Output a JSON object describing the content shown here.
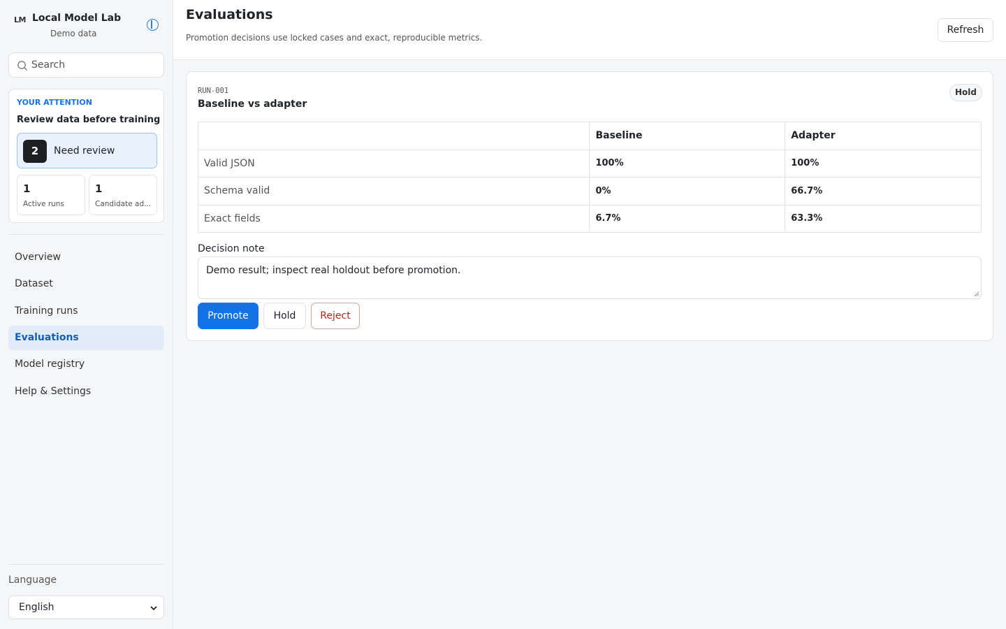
{
  "sidebar": {
    "logo_text": "LM",
    "app_name": "Local Model Lab",
    "app_sub": "Demo data",
    "search": {
      "placeholder": "Search"
    },
    "attention": {
      "eyebrow": "YOUR ATTENTION",
      "title": "Review data before training",
      "review_count": "2",
      "review_label": "Need review",
      "stats": [
        {
          "value": "1",
          "label": "Active runs"
        },
        {
          "value": "1",
          "label": "Candidate ad..."
        }
      ]
    },
    "nav": [
      {
        "label": "Overview",
        "active": false
      },
      {
        "label": "Dataset",
        "active": false
      },
      {
        "label": "Training runs",
        "active": false
      },
      {
        "label": "Evaluations",
        "active": true
      },
      {
        "label": "Model registry",
        "active": false
      },
      {
        "label": "Help & Settings",
        "active": false
      }
    ],
    "language": {
      "label": "Language",
      "value": "English"
    }
  },
  "header": {
    "title": "Evaluations",
    "subtitle": "Promotion decisions use locked cases and exact, reproducible metrics.",
    "refresh_label": "Refresh"
  },
  "evaluation": {
    "run_id": "RUN-001",
    "title": "Baseline vs adapter",
    "status": "Hold",
    "columns": [
      "",
      "Baseline",
      "Adapter"
    ],
    "rows": [
      {
        "metric": "Valid JSON",
        "baseline": "100%",
        "adapter": "100%"
      },
      {
        "metric": "Schema valid",
        "baseline": "0%",
        "adapter": "66.7%"
      },
      {
        "metric": "Exact fields",
        "baseline": "6.7%",
        "adapter": "63.3%"
      }
    ],
    "note_label": "Decision note",
    "note_value": "Demo result; inspect real holdout before promotion.",
    "actions": {
      "promote": "Promote",
      "hold": "Hold",
      "reject": "Reject"
    }
  },
  "colors": {
    "accent": "#1373e6",
    "active_nav_bg": "#e2ecf8",
    "reject": "#b3261e",
    "review_tile_bg": "#e8f1fc"
  }
}
